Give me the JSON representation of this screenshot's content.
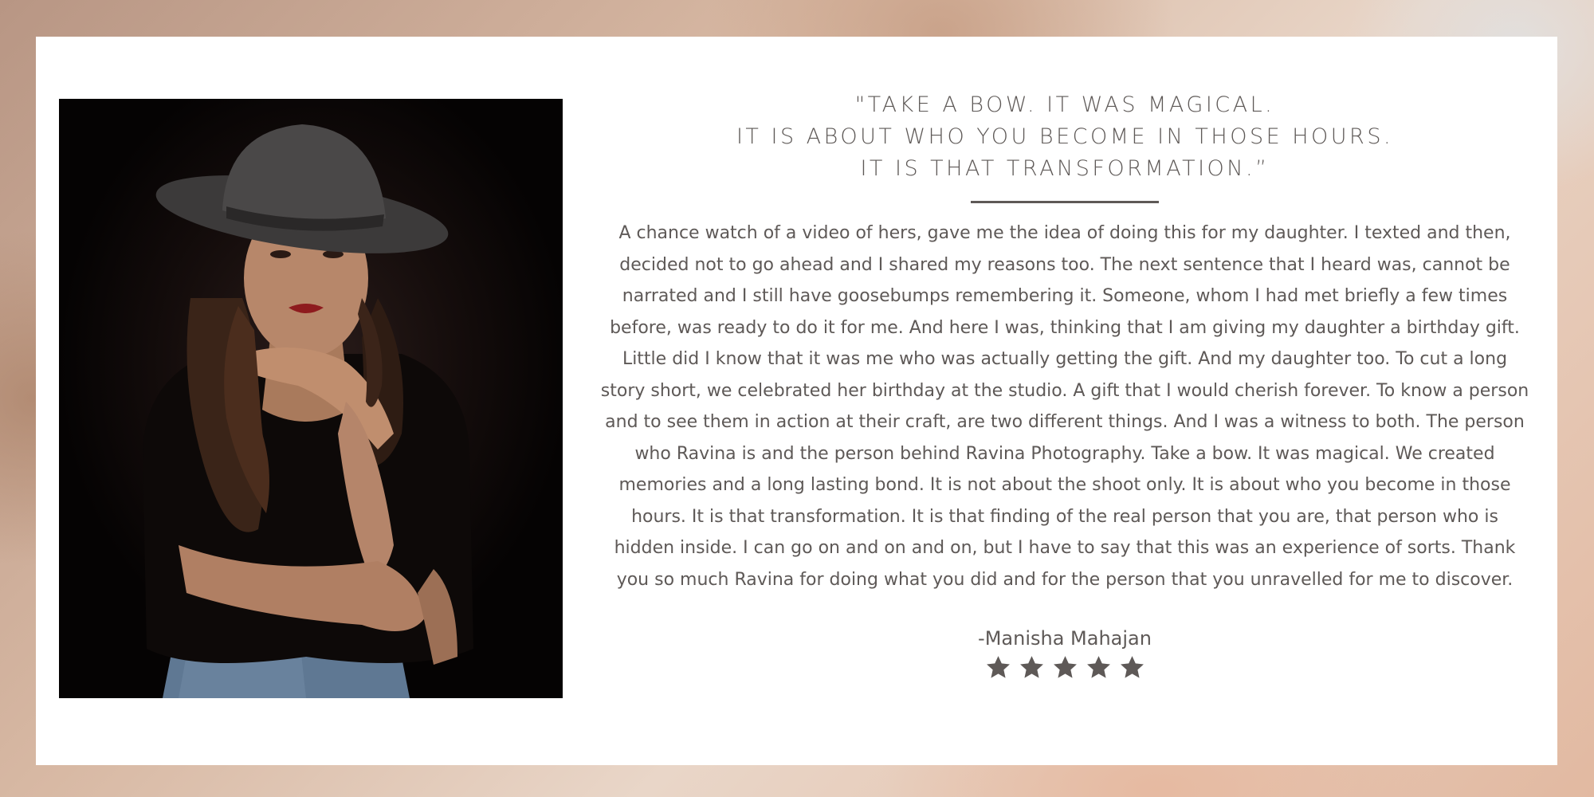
{
  "testimonial": {
    "headline_lines": [
      "\"TAKE A BOW. IT WAS MAGICAL.",
      "IT IS ABOUT WHO YOU BECOME IN THOSE HOURS.",
      "IT IS THAT TRANSFORMATION.”"
    ],
    "body": "A chance watch of a video of hers, gave me the idea of doing this for my daughter. I texted and then, decided not to go ahead and I shared my reasons too. The next sentence that I heard was, cannot be narrated and I still have goosebumps remembering it. Someone, whom I had met briefly a few times before, was ready to do it for me. And here I was, thinking that I am giving my daughter a birthday gift. Little did I know that it was me who was actually getting the gift. And my daughter too. To cut a long story short, we celebrated her birthday at the studio. A gift that I would cherish forever. To know a person and to see them in action at their craft, are two different things. And I was a witness to both. The person who Ravina is and the person behind Ravina Photography. Take a bow. It was magical. We created memories and a long lasting bond. It is not about the shoot only. It is about who you become in those hours. It is that transformation. It is that finding of the real person that you are, that person who is hidden inside. I can go on and on and on, but I have to say that this was an experience of sorts.  Thank you so much Ravina for doing what you did and for the person that you unravelled for me to discover.",
    "author": "-Manisha Mahajan",
    "rating": 5,
    "rating_max": 5
  },
  "colors": {
    "text": "#5e5957",
    "card_background": "#ffffff",
    "star": "#5e5957"
  },
  "icons": {
    "rating": "star-icon"
  }
}
